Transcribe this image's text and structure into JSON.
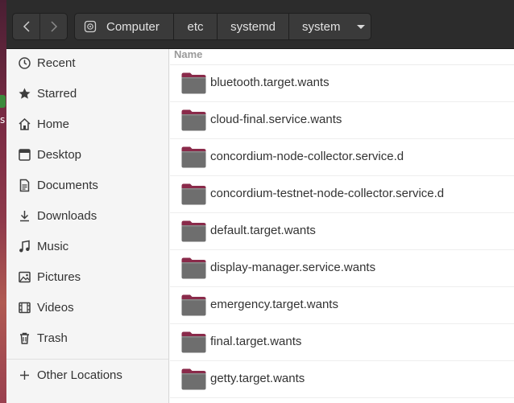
{
  "header": {
    "breadcrumbs": [
      "Computer",
      "etc",
      "systemd",
      "system"
    ]
  },
  "sidebar": {
    "items": [
      {
        "label": "Recent",
        "icon": "clock-icon"
      },
      {
        "label": "Starred",
        "icon": "star-icon"
      },
      {
        "label": "Home",
        "icon": "home-icon"
      },
      {
        "label": "Desktop",
        "icon": "desktop-icon"
      },
      {
        "label": "Documents",
        "icon": "document-icon"
      },
      {
        "label": "Downloads",
        "icon": "download-icon"
      },
      {
        "label": "Music",
        "icon": "music-icon"
      },
      {
        "label": "Pictures",
        "icon": "picture-icon"
      },
      {
        "label": "Videos",
        "icon": "video-icon"
      },
      {
        "label": "Trash",
        "icon": "trash-icon"
      },
      {
        "label": "Other Locations",
        "icon": "plus-icon"
      }
    ]
  },
  "list": {
    "column_name": "Name",
    "rows": [
      "bluetooth.target.wants",
      "cloud-final.service.wants",
      "concordium-node-collector.service.d",
      "concordium-testnet-node-collector.service.d",
      "default.target.wants",
      "display-manager.service.wants",
      "emergency.target.wants",
      "final.target.wants",
      "getty.target.wants"
    ]
  },
  "colors": {
    "headerbar": "#2c2c2c",
    "sidebar": "#f5f5f5",
    "folder_body": "#6e6e6e",
    "folder_tab": "#8a2a4a"
  }
}
